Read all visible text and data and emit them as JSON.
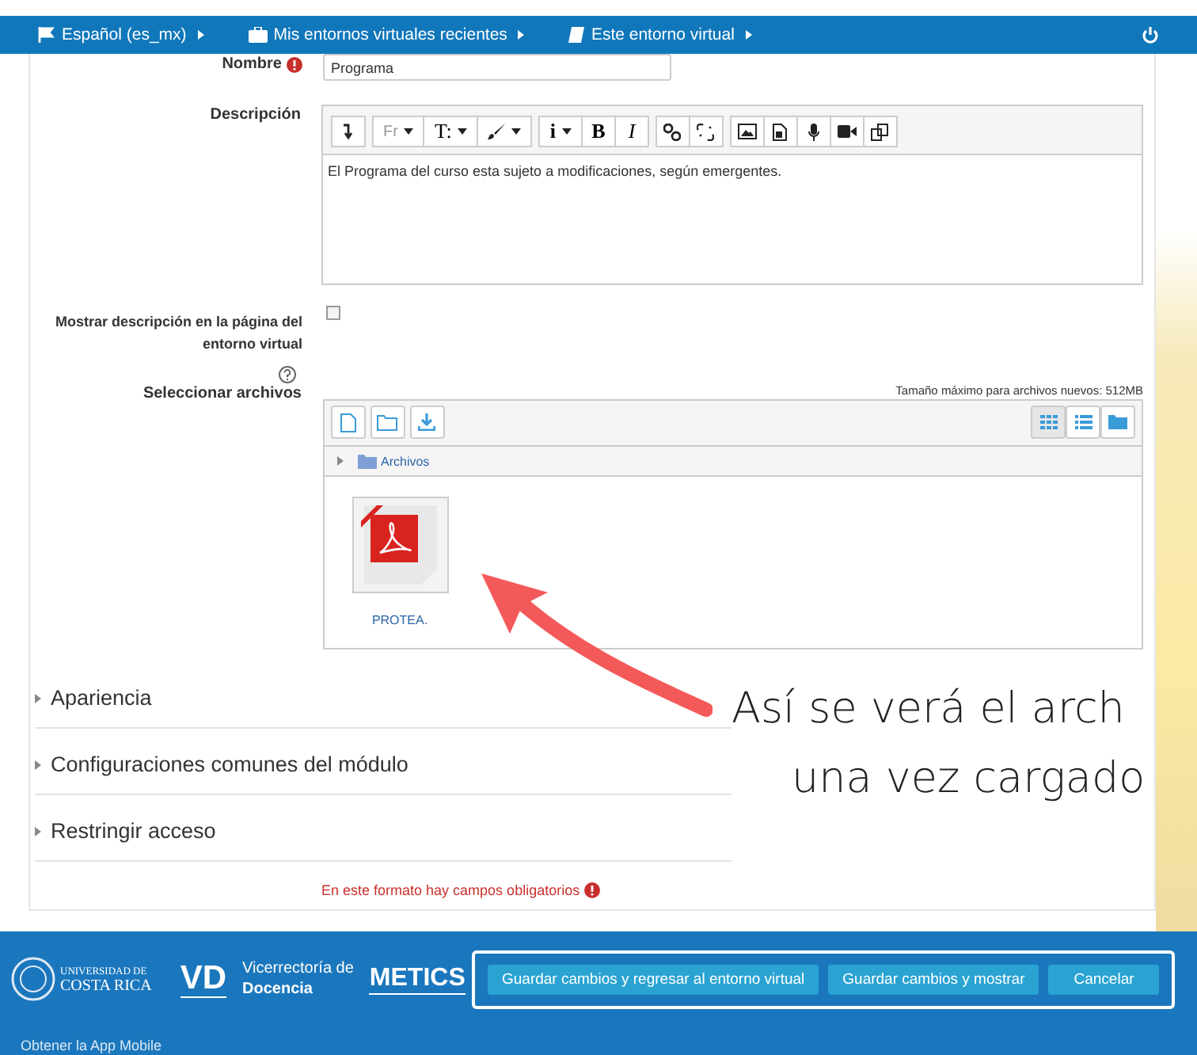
{
  "navbar": {
    "items": [
      {
        "label": "Español (es_mx)"
      },
      {
        "label": "Mis entornos virtuales recientes"
      },
      {
        "label": "Este entorno virtual"
      }
    ]
  },
  "form": {
    "name": {
      "label": "Nombre",
      "value": "Programa"
    },
    "description": {
      "label": "Descripción",
      "toolbar_labels": [
        "Fr",
        "T:",
        "i",
        "B",
        "I"
      ],
      "value": "El Programa del curso esta sujeto a modificaciones, según emergentes."
    },
    "show_description": {
      "label": "Mostrar descripción en la página del entorno virtual",
      "checked": false
    },
    "files": {
      "label": "Seleccionar archivos",
      "max_size": "Tamaño máximo para archivos nuevos: 512MB",
      "path": "Archivos",
      "items": [
        {
          "name": "PROTEA."
        }
      ]
    },
    "sections": [
      {
        "label": "Apariencia",
        "expanded": false
      },
      {
        "label": "Configuraciones comunes del módulo",
        "expanded": false
      },
      {
        "label": "Restringir acceso",
        "expanded": false
      }
    ],
    "required_note": "En este formato hay campos obligatorios"
  },
  "annotation": {
    "lines": [
      "Así se verá el arch",
      "una vez cargado"
    ]
  },
  "footer": {
    "ucr": [
      "UNIVERSIDAD DE",
      "COSTA RICA"
    ],
    "vd": "VD",
    "vd_text": [
      "Vicerrectoría de",
      "Docencia"
    ],
    "metics": "METICS",
    "buttons": [
      "Guardar cambios y regresar al entorno virtual",
      "Guardar cambios y mostrar",
      "Cancelar"
    ],
    "app_link": "Obtener la App Mobile"
  }
}
